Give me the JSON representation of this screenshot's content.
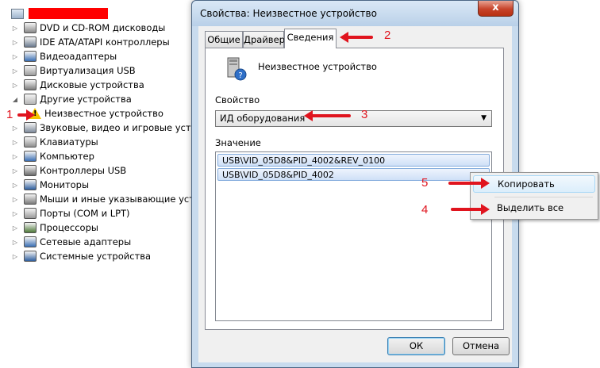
{
  "device_manager": {
    "items": [
      {
        "label": "DVD и CD-ROM дисководы",
        "icon": "dvd-drive-icon",
        "color": "#8a8a8a",
        "expanded": false
      },
      {
        "label": "IDE ATA/ATAPI контроллеры",
        "icon": "ide-controller-icon",
        "color": "#6b7b8f",
        "expanded": false
      },
      {
        "label": "Видеоадаптеры",
        "icon": "display-adapter-icon",
        "color": "#3a6fb5",
        "expanded": false
      },
      {
        "label": "Виртуализация USB",
        "icon": "usb-virtualization-icon",
        "color": "#9a9a9a",
        "expanded": false
      },
      {
        "label": "Дисковые устройства",
        "icon": "disk-drive-icon",
        "color": "#7d7d7d",
        "expanded": false
      },
      {
        "label": "Другие устройства",
        "icon": "other-devices-icon",
        "color": "#b5b5b5",
        "expanded": true
      },
      {
        "label": "Неизвестное устройство",
        "icon": "unknown-device-warning-icon",
        "color": "#f5c400",
        "child": true
      },
      {
        "label": "Звуковые, видео и игровые устройства",
        "icon": "sound-icon",
        "color": "#7d8a9a",
        "expanded": false
      },
      {
        "label": "Клавиатуры",
        "icon": "keyboard-icon",
        "color": "#8f8f8f",
        "expanded": false
      },
      {
        "label": "Компьютер",
        "icon": "computer-icon",
        "color": "#3a6fb5",
        "expanded": false
      },
      {
        "label": "Контроллеры USB",
        "icon": "usb-controller-icon",
        "color": "#6b6b6b",
        "expanded": false
      },
      {
        "label": "Мониторы",
        "icon": "monitor-icon",
        "color": "#2f5f9f",
        "expanded": false
      },
      {
        "label": "Мыши и иные указывающие устройства",
        "icon": "mouse-icon",
        "color": "#7a7a7a",
        "expanded": false
      },
      {
        "label": "Порты (COM и LPT)",
        "icon": "port-icon",
        "color": "#9a9a9a",
        "expanded": false
      },
      {
        "label": "Процессоры",
        "icon": "processor-icon",
        "color": "#4f7a3a",
        "expanded": false
      },
      {
        "label": "Сетевые адаптеры",
        "icon": "network-adapter-icon",
        "color": "#3a6fb5",
        "expanded": false
      },
      {
        "label": "Системные устройства",
        "icon": "system-devices-icon",
        "color": "#2f5f9f",
        "expanded": false
      }
    ]
  },
  "dialog": {
    "title": "Свойства: Неизвестное устройство",
    "close_glyph": "x",
    "tabs": [
      {
        "label": "Общие",
        "active": false
      },
      {
        "label": "Драйвер",
        "active": false
      },
      {
        "label": "Сведения",
        "active": true
      }
    ],
    "device_name": "Неизвестное устройство",
    "property_label": "Свойство",
    "property_value": "ИД оборудования",
    "value_label": "Значение",
    "values": [
      "USB\\VID_05D8&PID_4002&REV_0100",
      "USB\\VID_05D8&PID_4002"
    ],
    "ok_label": "ОК",
    "cancel_label": "Отмена"
  },
  "context_menu": {
    "items": [
      {
        "label": "Копировать",
        "highlighted": true
      },
      {
        "label": "Выделить все",
        "highlighted": false
      }
    ]
  },
  "annotations": {
    "labels": [
      "1",
      "2",
      "3",
      "4",
      "5"
    ],
    "color": "#e0141e"
  }
}
